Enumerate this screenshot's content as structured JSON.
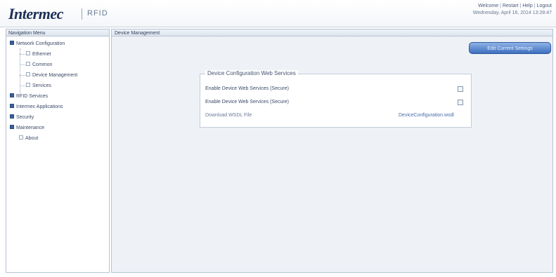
{
  "header": {
    "logo_text": "Intermec",
    "product": "RFID",
    "links": [
      "Welcome",
      "Restart",
      "Help",
      "Logout"
    ],
    "datetime": "Wednesday, April 16, 2014 13:28:47"
  },
  "nav": {
    "title": "Navigation Menu",
    "items": [
      {
        "label": "Network Configuration",
        "marker": "filled"
      },
      {
        "label": "Ethernet",
        "marker": "empty"
      },
      {
        "label": "Common",
        "marker": "empty"
      },
      {
        "label": "Device Management",
        "marker": "empty"
      },
      {
        "label": "Services",
        "marker": "empty"
      },
      {
        "label": "RFID Services",
        "marker": "filled"
      },
      {
        "label": "Intermec Applications",
        "marker": "filled"
      },
      {
        "label": "Security",
        "marker": "filled"
      },
      {
        "label": "Maintenance",
        "marker": "filled"
      },
      {
        "label": "About",
        "marker": "empty"
      }
    ]
  },
  "main": {
    "title": "Device Management",
    "edit_button": "Edit Current Settings",
    "fieldset": {
      "legend": "Device Configuration Web Services",
      "rows": [
        {
          "label": "Enable Device Web Services (Secure)",
          "checked": false
        },
        {
          "label": "Enable Device Web Services (Secure)",
          "checked": false
        }
      ],
      "download_label": "Download WSDL File",
      "download_link": "DeviceConfiguration.wsdl"
    }
  }
}
